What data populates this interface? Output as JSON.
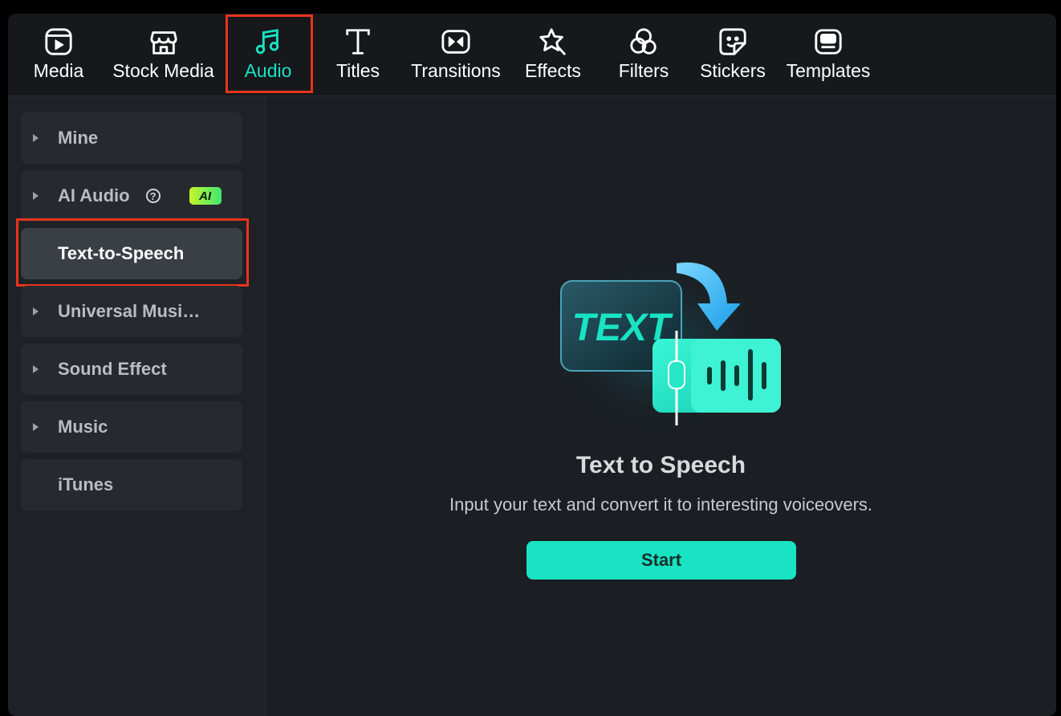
{
  "toolbar": {
    "tabs": [
      {
        "label": "Media",
        "icon": "media-icon",
        "active": false
      },
      {
        "label": "Stock Media",
        "icon": "stock-media-icon",
        "active": false
      },
      {
        "label": "Audio",
        "icon": "music-note-icon",
        "active": true
      },
      {
        "label": "Titles",
        "icon": "titles-icon",
        "active": false
      },
      {
        "label": "Transitions",
        "icon": "transitions-icon",
        "active": false
      },
      {
        "label": "Effects",
        "icon": "effects-icon",
        "active": false
      },
      {
        "label": "Filters",
        "icon": "filters-icon",
        "active": false
      },
      {
        "label": "Stickers",
        "icon": "stickers-icon",
        "active": false
      },
      {
        "label": "Templates",
        "icon": "templates-icon",
        "active": false
      }
    ]
  },
  "sidebar": {
    "items": [
      {
        "label": "Mine",
        "expandable": true
      },
      {
        "label": "AI Audio",
        "expandable": true,
        "help_icon": "?",
        "badge": "AI"
      },
      {
        "label": "Text-to-Speech",
        "expandable": false,
        "selected": true
      },
      {
        "label": "Universal Musi…",
        "expandable": true
      },
      {
        "label": "Sound Effect",
        "expandable": true
      },
      {
        "label": "Music",
        "expandable": true
      },
      {
        "label": "iTunes",
        "expandable": false
      }
    ]
  },
  "main": {
    "illustration_text": "TEXT",
    "title": "Text to Speech",
    "description": "Input your text and convert it to interesting voiceovers.",
    "start_label": "Start"
  },
  "colors": {
    "accent": "#19e3c2",
    "highlight_box": "#e8341c",
    "background": "#1b1e22"
  }
}
